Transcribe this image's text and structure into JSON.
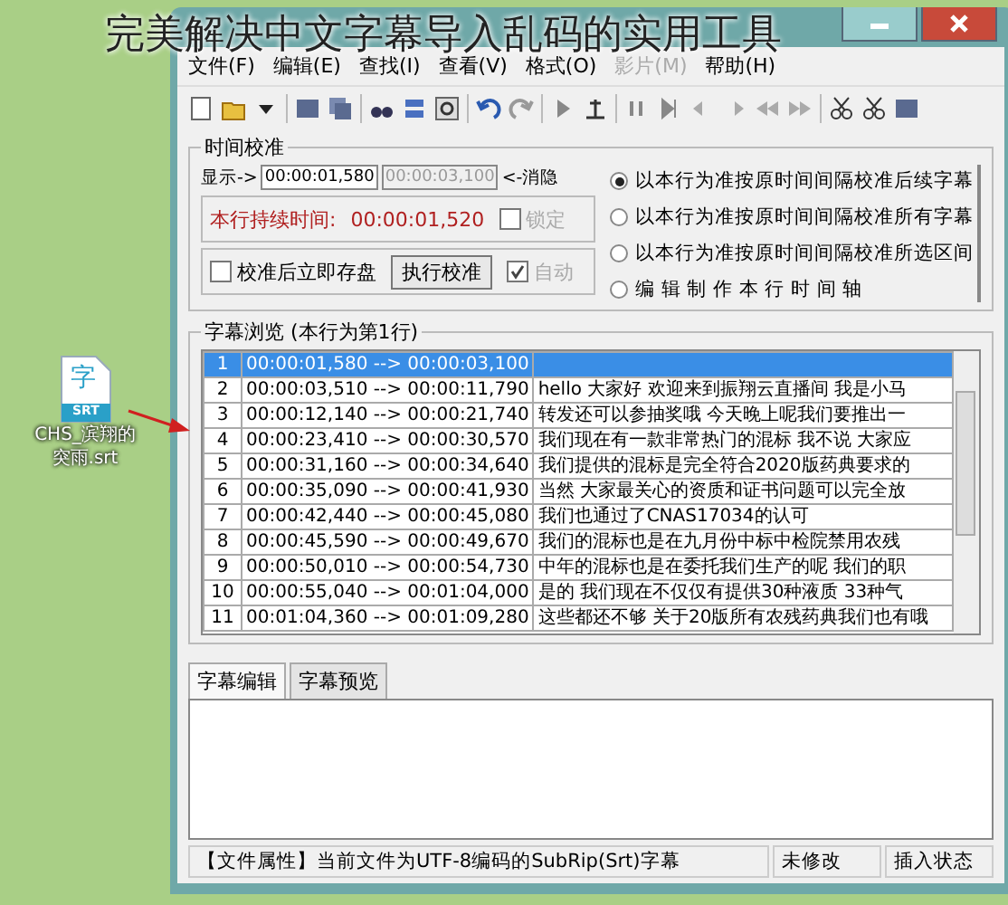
{
  "caption": "完美解决中文字幕导入乱码的实用工具",
  "desktop_icon": {
    "badge": "SRT",
    "glyph": "字",
    "label_lines": [
      "CHS_滨翔的",
      "突雨.srt"
    ]
  },
  "menu": [
    {
      "label": "文件(F)",
      "disabled": false
    },
    {
      "label": "编辑(E)",
      "disabled": false
    },
    {
      "label": "查找(I)",
      "disabled": false
    },
    {
      "label": "查看(V)",
      "disabled": false
    },
    {
      "label": "格式(O)",
      "disabled": false
    },
    {
      "label": "影片(M)",
      "disabled": true
    },
    {
      "label": "帮助(H)",
      "disabled": false
    }
  ],
  "calibration": {
    "title": "时间校准",
    "show_label": "显示->",
    "start": "00:00:01,580",
    "end": "00:00:03,100",
    "hint": "<-消隐",
    "duration_label": "本行持续时间:",
    "duration": "00:00:01,520",
    "lock": {
      "label": "锁定",
      "checked": false,
      "disabled": true
    },
    "save_after": {
      "label": "校准后立即存盘",
      "checked": false,
      "disabled": false
    },
    "run_button": "执行校准",
    "auto": {
      "label": "自动",
      "checked": true,
      "disabled": true
    },
    "options": [
      {
        "label": "以本行为准按原时间间隔校准后续字幕",
        "selected": true
      },
      {
        "label": "以本行为准按原时间间隔校准所有字幕",
        "selected": false
      },
      {
        "label": "以本行为准按原时间间隔校准所选区间",
        "selected": false
      },
      {
        "label": "编 辑 制 作 本 行 时 间 轴",
        "selected": false
      }
    ]
  },
  "browser": {
    "title": "字幕浏览 (本行为第1行)",
    "rows": [
      {
        "index": "1",
        "time": "00:00:01,580 --> 00:00:03,100",
        "text": "",
        "selected": true
      },
      {
        "index": "2",
        "time": "00:00:03,510 --> 00:00:11,790",
        "text": "hello 大家好 欢迎来到振翔云直播间 我是小马",
        "selected": false
      },
      {
        "index": "3",
        "time": "00:00:12,140 --> 00:00:21,740",
        "text": "转发还可以参抽奖哦 今天晚上呢我们要推出一",
        "selected": false
      },
      {
        "index": "4",
        "time": "00:00:23,410 --> 00:00:30,570",
        "text": "我们现在有一款非常热门的混标 我不说 大家应",
        "selected": false
      },
      {
        "index": "5",
        "time": "00:00:31,160 --> 00:00:34,640",
        "text": "我们提供的混标是完全符合2020版药典要求的",
        "selected": false
      },
      {
        "index": "6",
        "time": "00:00:35,090 --> 00:00:41,930",
        "text": "当然 大家最关心的资质和证书问题可以完全放",
        "selected": false
      },
      {
        "index": "7",
        "time": "00:00:42,440 --> 00:00:45,080",
        "text": "我们也通过了CNAS17034的认可",
        "selected": false
      },
      {
        "index": "8",
        "time": "00:00:45,590 --> 00:00:49,670",
        "text": "我们的混标也是在九月份中标中检院禁用农残",
        "selected": false
      },
      {
        "index": "9",
        "time": "00:00:50,010 --> 00:00:54,730",
        "text": "中年的混标也是在委托我们生产的呢 我们的职",
        "selected": false
      },
      {
        "index": "10",
        "time": "00:00:55,040 --> 00:01:04,000",
        "text": "是的 我们现在不仅仅有提供30种液质 33种气",
        "selected": false
      },
      {
        "index": "11",
        "time": "00:01:04,360 --> 00:01:09,280",
        "text": "这些都还不够 关于20版所有农残药典我们也有哦",
        "selected": false
      }
    ]
  },
  "tabs": [
    {
      "label": "字幕编辑",
      "selected": true
    },
    {
      "label": "字幕预览",
      "selected": false
    }
  ],
  "status_bar": [
    "【文件属性】当前文件为UTF-8编码的SubRip(Srt)字幕",
    "未修改",
    "插入状态"
  ]
}
